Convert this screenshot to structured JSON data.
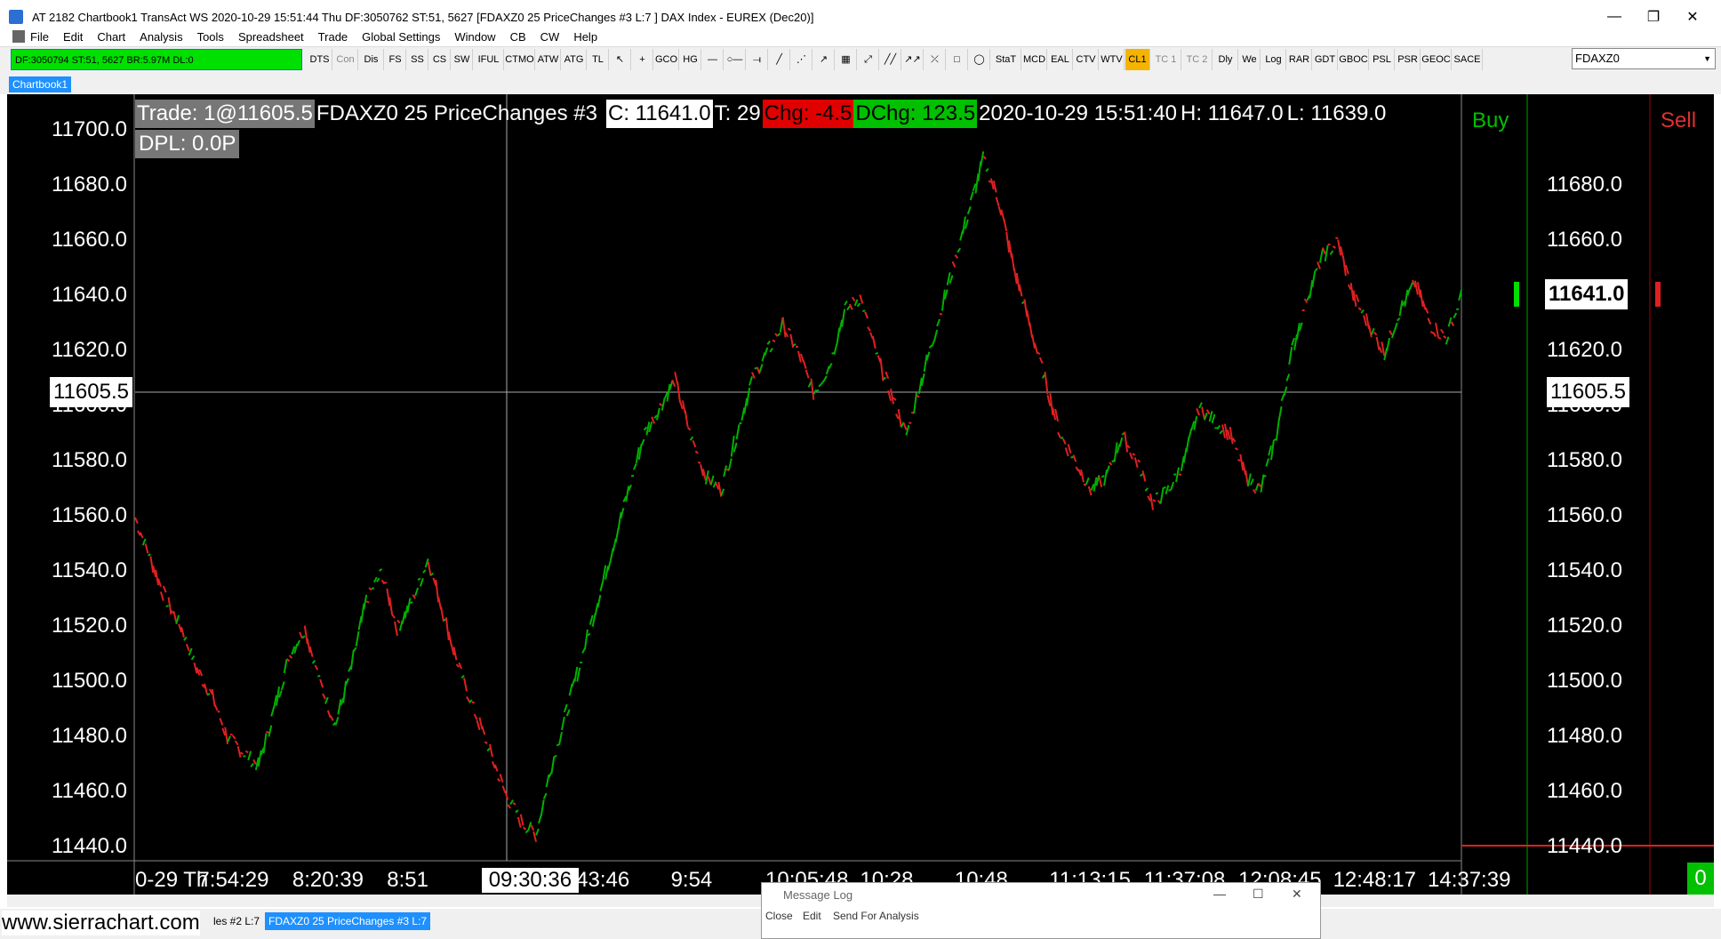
{
  "window": {
    "title": "AT 2182 Chartbook1  TransAct WS 2020-10-29  15:51:44 Thu  DF:3050762  ST:51, 5627  [FDAXZ0  25 PriceChanges  #3  L:7 ] DAX Index - EUREX (Dec20)]",
    "minimize": "—",
    "maximize": "❐",
    "close": "✕"
  },
  "menu": [
    "File",
    "Edit",
    "Chart",
    "Analysis",
    "Tools",
    "Spreadsheet",
    "Trade",
    "Global Settings",
    "Window",
    "CB",
    "CW",
    "Help"
  ],
  "status_text": "DF:3050794  ST:51, 5627  BR:5.97M  DL:0",
  "toolbar": {
    "buttons": [
      "DTS",
      "Con",
      "Dis",
      "FS",
      "SS",
      "CS",
      "SW",
      "IFUL",
      "CTMO",
      "ATW",
      "ATG",
      "TL",
      "↖",
      "+",
      "GCO",
      "HG",
      "—",
      "○—",
      "⟞",
      "╱",
      "⋰",
      "↗",
      "▦",
      "⤢",
      "╱╱",
      "↗↗",
      "⤫",
      "□",
      "◯",
      "StaT",
      "MCD",
      "EAL",
      "CTV",
      "WTV",
      "CL1",
      "TC 1",
      "TC 2",
      "Dly",
      "We",
      "Log",
      "RAR",
      "GDT",
      "GBOC",
      "PSL",
      "PSR",
      "GEOC",
      "SACE"
    ],
    "active": "CL1",
    "symbol": "FDAXZ0"
  },
  "chartbook_tab": "Chartbook1",
  "header": {
    "trade": "Trade: 1@11605.5",
    "symbol_info": "FDAXZ0  25 PriceChanges  #3",
    "close": "C: 11641.0",
    "trades": "T: 29",
    "chg": "Chg: -4.5",
    "dchg": "DChg: 123.5",
    "datetime": "2020-10-29  15:51:40",
    "high": "H: 11647.0",
    "low": "L: 11639.0",
    "dpl": "DPL: 0.0P"
  },
  "colors": {
    "up": "#00b000",
    "down": "#e02020",
    "bg": "#000000",
    "neg": "#e00000",
    "pos": "#00c000"
  },
  "y_axis": {
    "left_ticks": [
      "11700.0",
      "11680.0",
      "11660.0",
      "11640.0",
      "11620.0",
      "11600.0",
      "11580.0",
      "11560.0",
      "11540.0",
      "11520.0",
      "11500.0",
      "11480.0",
      "11460.0",
      "11440.0"
    ],
    "right_ticks": [
      "11680.0",
      "11660.0",
      "11640.0",
      "11620.0",
      "11600.0",
      "11580.0",
      "11560.0",
      "11540.0",
      "11520.0",
      "11500.0",
      "11480.0",
      "11460.0",
      "11440.0"
    ],
    "crosshair_price": "11605.5",
    "last_price": "11641.0"
  },
  "x_axis": {
    "labels": [
      "0-29 Th",
      "7:54:29",
      "8:20:39",
      "8:51",
      "09:30:36",
      "43:46",
      "9:54",
      "10:05:48",
      "10:28",
      "10:48",
      "11:13:15",
      "11:37:08",
      "12:08:45",
      "12:48:17",
      "14:37:39"
    ],
    "highlight": "09:30:36"
  },
  "dom": {
    "buy": "Buy",
    "sell": "Sell",
    "counter": "0"
  },
  "bottom": {
    "watermark": "www.sierrachart.com",
    "tab1": "les  #2  L:7",
    "tab2": "FDAXZ0  25 PriceChanges  #3  L:7"
  },
  "message_log": {
    "title": "Message Log",
    "menu": [
      "Close",
      "Edit",
      "Send For Analysis"
    ]
  },
  "chart_data": {
    "type": "line",
    "ylim": [
      11440,
      11700
    ],
    "y": [
      11560,
      11545,
      11530,
      11520,
      11505,
      11495,
      11480,
      11475,
      11470,
      11490,
      11510,
      11520,
      11500,
      11485,
      11505,
      11530,
      11540,
      11520,
      11530,
      11545,
      11525,
      11505,
      11490,
      11475,
      11460,
      11450,
      11445,
      11470,
      11490,
      11510,
      11530,
      11550,
      11570,
      11590,
      11600,
      11610,
      11590,
      11575,
      11570,
      11590,
      11610,
      11620,
      11630,
      11620,
      11605,
      11615,
      11635,
      11640,
      11620,
      11605,
      11590,
      11610,
      11630,
      11650,
      11670,
      11690,
      11675,
      11650,
      11630,
      11610,
      11590,
      11580,
      11570,
      11575,
      11590,
      11580,
      11565,
      11570,
      11580,
      11600,
      11595,
      11590,
      11575,
      11570,
      11590,
      11620,
      11640,
      11655,
      11660,
      11640,
      11630,
      11620,
      11635,
      11645,
      11630,
      11625,
      11640
    ]
  }
}
